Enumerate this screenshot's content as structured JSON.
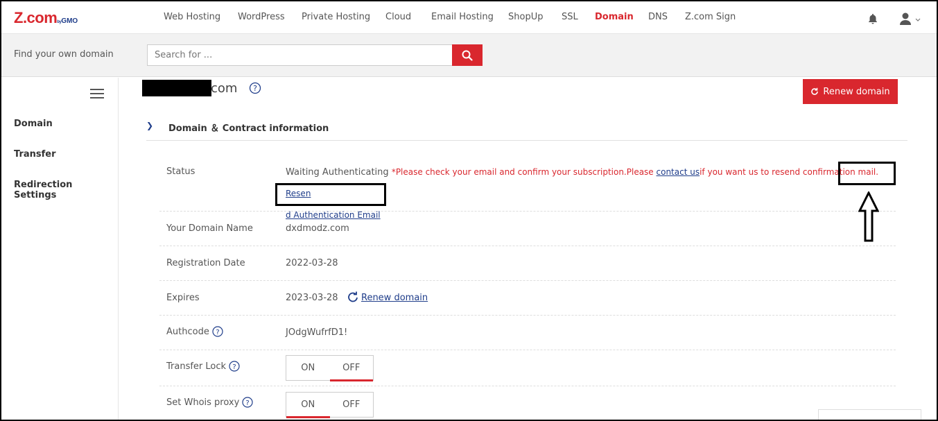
{
  "brand": {
    "logo_main": "Z.com",
    "logo_by": "by",
    "logo_gmo": "GMO"
  },
  "nav": {
    "items": [
      {
        "label": "Web Hosting",
        "active": false
      },
      {
        "label": "WordPress",
        "active": false
      },
      {
        "label": "Private Hosting",
        "active": false
      },
      {
        "label": "Cloud",
        "active": false
      },
      {
        "label": "Email Hosting",
        "active": false
      },
      {
        "label": "ShopUp",
        "active": false
      },
      {
        "label": "SSL",
        "active": false
      },
      {
        "label": "Domain",
        "active": true
      },
      {
        "label": "DNS",
        "active": false
      },
      {
        "label": "Z.com Sign",
        "active": false
      }
    ],
    "icons": {
      "bell": "bell-icon",
      "user": "user-icon"
    }
  },
  "search": {
    "label": "Find your own domain",
    "placeholder": "Search for ...",
    "icon": "search-icon"
  },
  "sidebar": {
    "items": [
      {
        "label": "Domain"
      },
      {
        "label": "Transfer"
      },
      {
        "label": "Redirection Settings"
      }
    ]
  },
  "header": {
    "title_suffix": "com",
    "renew_label": "Renew domain"
  },
  "section": {
    "title": "Domain ＆ Contract information"
  },
  "details": {
    "status": {
      "label": "Status",
      "value": "Waiting Authenticating",
      "warning_prefix": "*Please check your email and confirm your subscription.Please ",
      "contact_link": "contact us",
      "warning_suffix": "if you want us to resend confirmation mail. ",
      "resend_part1": "Resen",
      "resend_part2": "d Authentication Email"
    },
    "domain_name": {
      "label": "Your Domain Name",
      "value": "dxdmodz.com"
    },
    "registration": {
      "label": "Registration Date",
      "value": "2022-03-28"
    },
    "expires": {
      "label": "Expires",
      "value": "2023-03-28",
      "renew_link": "Renew domain"
    },
    "authcode": {
      "label": "Authcode",
      "value": "JOdgWufrfD1!"
    },
    "transfer_lock": {
      "label": "Transfer Lock",
      "on": "ON",
      "off": "OFF",
      "selected": "OFF"
    },
    "whois_proxy": {
      "label": "Set Whois proxy",
      "on": "ON",
      "off": "OFF",
      "selected": "ON"
    }
  },
  "colors": {
    "accent": "#d9272e",
    "link": "#1f3d8a"
  }
}
